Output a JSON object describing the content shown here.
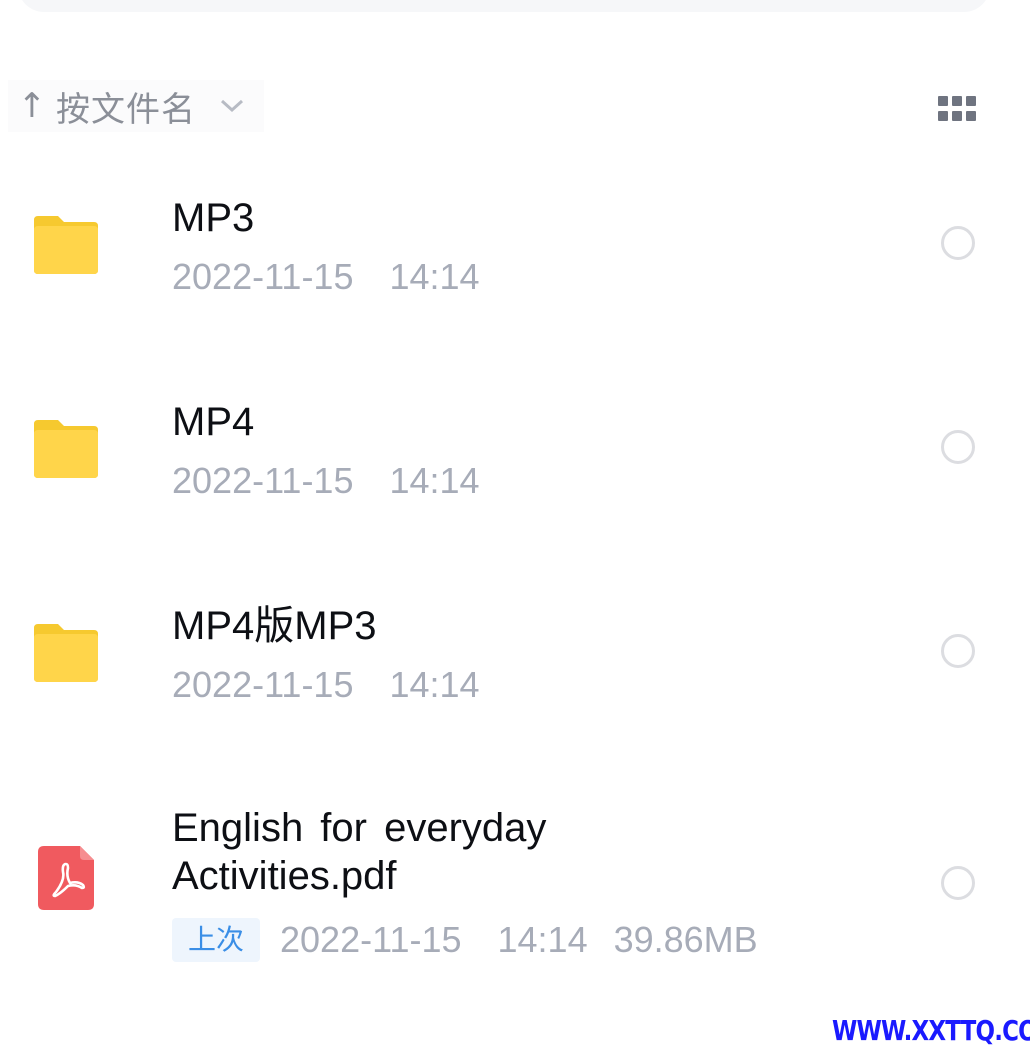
{
  "sort": {
    "arrow_icon": "↑",
    "label": "按文件名"
  },
  "view_toggle": {
    "icon": "grid-view-icon"
  },
  "files": [
    {
      "type": "folder",
      "name": "MP3",
      "date": "2022-11-15",
      "time": "14:14"
    },
    {
      "type": "folder",
      "name": "MP4",
      "date": "2022-11-15",
      "time": "14:14"
    },
    {
      "type": "folder",
      "name": "MP4版MP3",
      "date": "2022-11-15",
      "time": "14:14"
    },
    {
      "type": "pdf",
      "name": "English for everyday Activities.pdf",
      "badge": "上次",
      "date": "2022-11-15",
      "time": "14:14",
      "size": "39.86MB"
    }
  ],
  "colors": {
    "folder": "#ffd54a",
    "folder_tab": "#f6c92f",
    "pdf": "#f05a5f",
    "badge_text": "#3a8ee6",
    "badge_bg": "#eef5fd"
  },
  "watermark": "WWW.XXTTQ.COM"
}
